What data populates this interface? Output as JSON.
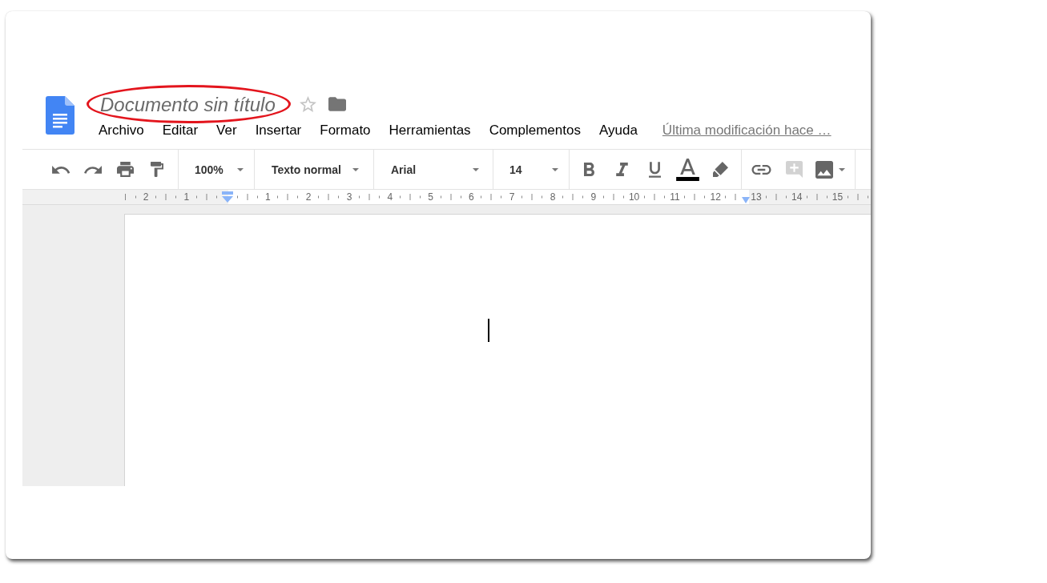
{
  "document": {
    "title": "Documento sin título",
    "title_highlighted": true,
    "starred": false,
    "menu": [
      "Archivo",
      "Editar",
      "Ver",
      "Insertar",
      "Formato",
      "Herramientas",
      "Complementos",
      "Ayuda"
    ],
    "last_edit": "Última modificación hace …"
  },
  "toolbar": {
    "zoom": "100%",
    "paragraph_style": "Texto normal",
    "font": "Arial",
    "font_size": "14",
    "text_color": {
      "color": "#000000"
    },
    "insert_buttons": [
      {
        "disabled": false
      },
      {
        "disabled": true
      },
      {
        "disabled": false
      }
    ]
  },
  "ruler": {
    "marks": [
      {
        "kind": "number",
        "label": "2"
      },
      {
        "kind": "number",
        "label": "1"
      },
      {
        "kind": "left-indent"
      },
      {
        "kind": "number",
        "label": "1"
      },
      {
        "kind": "number",
        "label": "2"
      },
      {
        "kind": "number",
        "label": "3"
      },
      {
        "kind": "number",
        "label": "4"
      },
      {
        "kind": "number",
        "label": "5"
      },
      {
        "kind": "number",
        "label": "6"
      },
      {
        "kind": "number",
        "label": "7"
      },
      {
        "kind": "number",
        "label": "8"
      },
      {
        "kind": "number",
        "label": "9"
      },
      {
        "kind": "number",
        "label": "10"
      },
      {
        "kind": "number",
        "label": "11"
      },
      {
        "kind": "number",
        "label": "12"
      },
      {
        "kind": "right-indent"
      },
      {
        "kind": "number",
        "label": "13"
      },
      {
        "kind": "number",
        "label": "14"
      },
      {
        "kind": "number",
        "label": "15"
      }
    ]
  },
  "page": {
    "cursor": true
  }
}
